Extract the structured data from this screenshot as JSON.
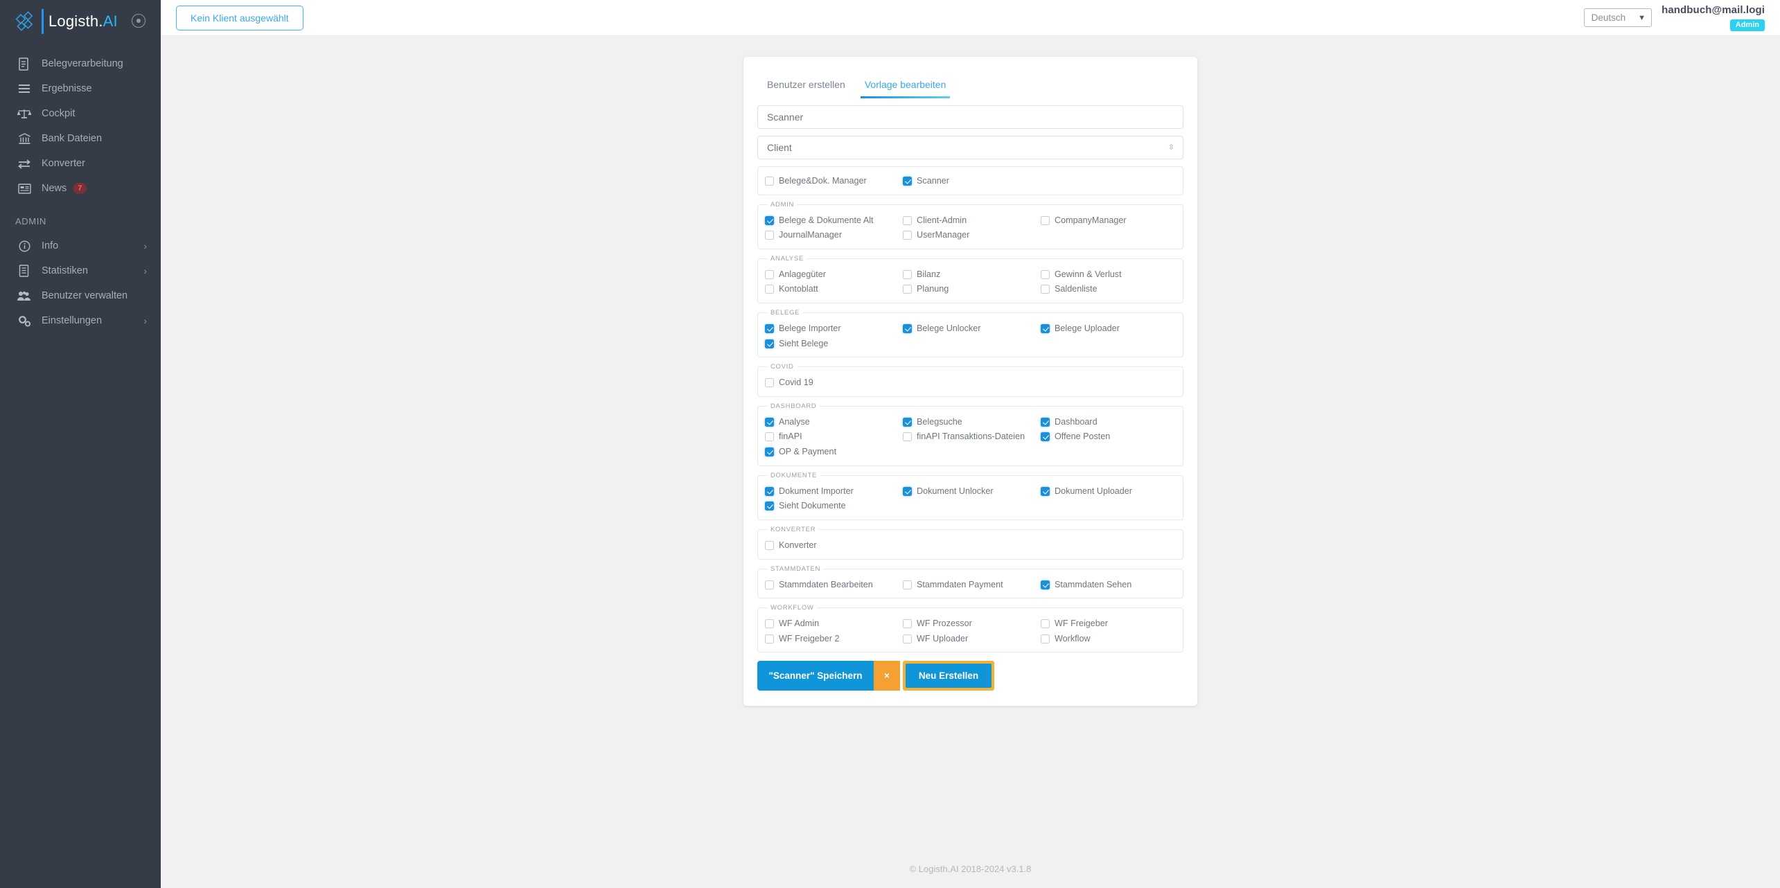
{
  "sidebar": {
    "logo": {
      "name": "Logisth.",
      "accent": "AI",
      "accent_color": "#29b6f6"
    },
    "collapse_icon": "collapse-icon",
    "items": [
      {
        "label": "Belegverarbeitung",
        "icon": "document-icon"
      },
      {
        "label": "Ergebnisse",
        "icon": "list-icon"
      },
      {
        "label": "Cockpit",
        "icon": "scales-icon"
      },
      {
        "label": "Bank Dateien",
        "icon": "bank-icon"
      },
      {
        "label": "Konverter",
        "icon": "exchange-icon"
      },
      {
        "label": "News",
        "icon": "news-icon",
        "badge": "7"
      }
    ],
    "admin_section_title": "ADMIN",
    "admin_items": [
      {
        "label": "Info",
        "icon": "info-icon",
        "chevron": true
      },
      {
        "label": "Statistiken",
        "icon": "book-icon",
        "chevron": true
      },
      {
        "label": "Benutzer verwalten",
        "icon": "users-icon",
        "chevron": false
      },
      {
        "label": "Einstellungen",
        "icon": "gears-icon",
        "chevron": true
      }
    ]
  },
  "topbar": {
    "client_button": "Kein Klient ausgewählt",
    "language": "Deutsch",
    "language_options": [
      "Deutsch"
    ],
    "user_email": "handbuch@mail.logi",
    "role_badge": "Admin",
    "role_badge_color": "#2ad2f2"
  },
  "card": {
    "tabs": [
      {
        "label": "Benutzer erstellen",
        "active": false
      },
      {
        "label": "Vorlage bearbeiten",
        "active": true
      }
    ],
    "name_field": {
      "value": "Scanner",
      "placeholder": "Scanner"
    },
    "client_field": {
      "value": "Client",
      "placeholder": "Client"
    },
    "groups": [
      {
        "legend": "",
        "items": [
          {
            "label": "Belege&Dok. Manager",
            "checked": false
          },
          {
            "label": "Scanner",
            "checked": true
          }
        ]
      },
      {
        "legend": "ADMIN",
        "items": [
          {
            "label": "Belege & Dokumente Alt",
            "checked": true
          },
          {
            "label": "Client-Admin",
            "checked": false
          },
          {
            "label": "CompanyManager",
            "checked": false
          },
          {
            "label": "JournalManager",
            "checked": false
          },
          {
            "label": "UserManager",
            "checked": false
          }
        ]
      },
      {
        "legend": "ANALYSE",
        "items": [
          {
            "label": "Anlagegüter",
            "checked": false
          },
          {
            "label": "Bilanz",
            "checked": false
          },
          {
            "label": "Gewinn & Verlust",
            "checked": false
          },
          {
            "label": "Kontoblatt",
            "checked": false
          },
          {
            "label": "Planung",
            "checked": false
          },
          {
            "label": "Saldenliste",
            "checked": false
          }
        ]
      },
      {
        "legend": "BELEGE",
        "items": [
          {
            "label": "Belege Importer",
            "checked": true
          },
          {
            "label": "Belege Unlocker",
            "checked": true
          },
          {
            "label": "Belege Uploader",
            "checked": true
          },
          {
            "label": "Sieht Belege",
            "checked": true
          }
        ]
      },
      {
        "legend": "COVID",
        "items": [
          {
            "label": "Covid 19",
            "checked": false
          }
        ]
      },
      {
        "legend": "DASHBOARD",
        "items": [
          {
            "label": "Analyse",
            "checked": true
          },
          {
            "label": "Belegsuche",
            "checked": true
          },
          {
            "label": "Dashboard",
            "checked": true
          },
          {
            "label": "finAPI",
            "checked": false
          },
          {
            "label": "finAPI Transaktions-Dateien",
            "checked": false
          },
          {
            "label": "Offene Posten",
            "checked": true
          },
          {
            "label": "OP & Payment",
            "checked": true
          }
        ]
      },
      {
        "legend": "DOKUMENTE",
        "items": [
          {
            "label": "Dokument Importer",
            "checked": true
          },
          {
            "label": "Dokument Unlocker",
            "checked": true
          },
          {
            "label": "Dokument Uploader",
            "checked": true
          },
          {
            "label": "Sieht Dokumente",
            "checked": true
          }
        ]
      },
      {
        "legend": "KONVERTER",
        "items": [
          {
            "label": "Konverter",
            "checked": false
          }
        ]
      },
      {
        "legend": "STAMMDATEN",
        "items": [
          {
            "label": "Stammdaten Bearbeiten",
            "checked": false
          },
          {
            "label": "Stammdaten Payment",
            "checked": false
          },
          {
            "label": "Stammdaten Sehen",
            "checked": true
          }
        ]
      },
      {
        "legend": "WORKFLOW",
        "items": [
          {
            "label": "WF Admin",
            "checked": false
          },
          {
            "label": "WF Prozessor",
            "checked": false
          },
          {
            "label": "WF Freigeber",
            "checked": false
          },
          {
            "label": "WF Freigeber 2",
            "checked": false
          },
          {
            "label": "WF Uploader",
            "checked": false
          },
          {
            "label": "Workflow",
            "checked": false
          }
        ]
      }
    ],
    "buttons": {
      "save": "\"Scanner\" Speichern",
      "cancel": "×",
      "new": "Neu Erstellen"
    }
  },
  "footer": {
    "text": "© Logisth.AI 2018-2024 v3.1.8"
  }
}
